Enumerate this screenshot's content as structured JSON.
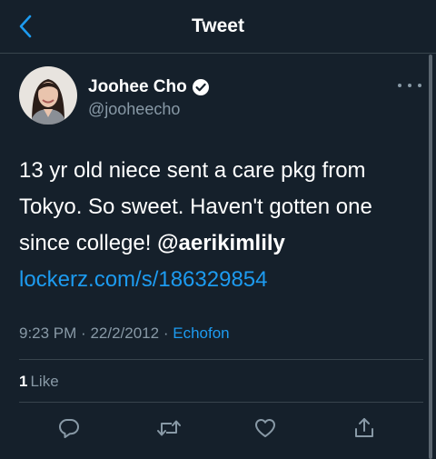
{
  "header": {
    "title": "Tweet"
  },
  "tweet": {
    "author": {
      "display_name": "Joohee Cho",
      "handle": "@jooheecho"
    },
    "text_part1": "13 yr old niece sent a care pkg from Tokyo. So sweet. Haven't gotten one since college! ",
    "mention": "@aerikimlily",
    "link": "lockerz.com/s/186329854",
    "time": "9:23 PM",
    "separator": "·",
    "date": "22/2/2012",
    "source": "Echofon",
    "likes_count": "1",
    "likes_label": "Like"
  },
  "icons": {
    "back": "chevron-left-icon",
    "verified": "verified-badge-icon",
    "more": "more-dots-icon",
    "reply": "reply-icon",
    "retweet": "retweet-icon",
    "like": "heart-icon",
    "share": "share-icon"
  },
  "colors": {
    "background": "#15202b",
    "accent": "#1d9bf0",
    "secondary_text": "#8899a6",
    "divider": "#38444d"
  }
}
